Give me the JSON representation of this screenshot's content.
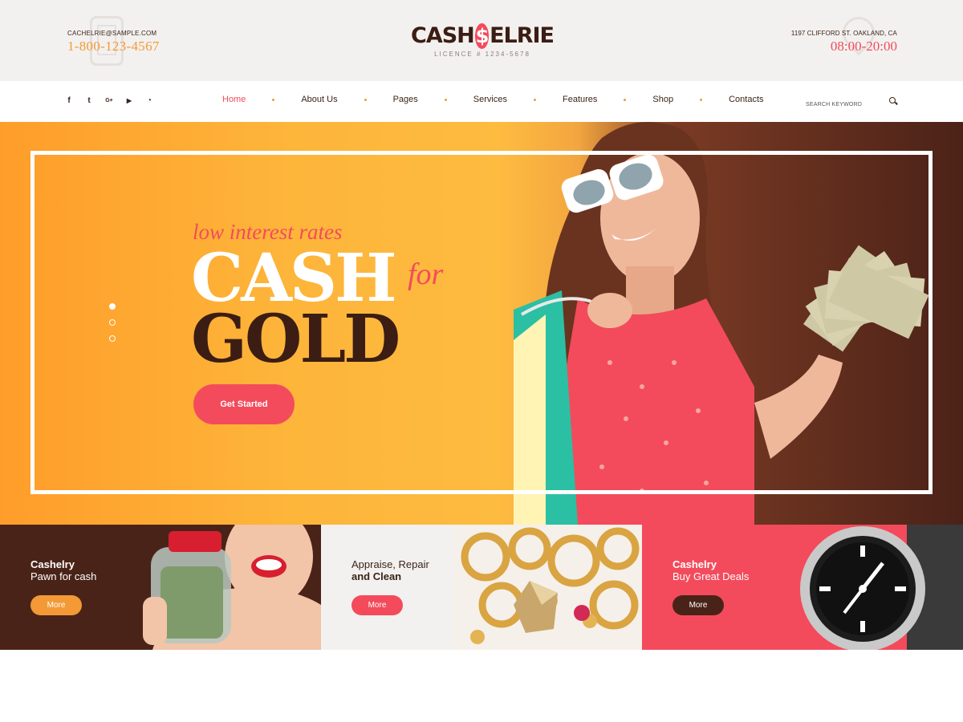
{
  "header": {
    "email": "CACHELRIE@SAMPLE.COM",
    "phone": "1-800-123-4567",
    "logo_left": "CASH",
    "logo_coin": "$",
    "logo_right": "ELRIE",
    "licence": "LICENCE # 1234-5678",
    "address": "1197 CLIFFORD ST. OAKLAND, CA",
    "hours": "08:00-20:00"
  },
  "social": [
    {
      "icon": "facebook-icon",
      "glyph": "f"
    },
    {
      "icon": "twitter-icon",
      "glyph": "t"
    },
    {
      "icon": "google-plus-icon",
      "glyph": "G+"
    },
    {
      "icon": "youtube-icon",
      "glyph": "▶"
    },
    {
      "icon": "rss-icon",
      "glyph": "◔"
    }
  ],
  "nav": {
    "items": [
      "Home",
      "About Us",
      "Pages",
      "Services",
      "Features",
      "Shop",
      "Contacts"
    ],
    "active": "Home"
  },
  "search": {
    "placeholder": "SEARCH KEYWORD"
  },
  "hero": {
    "tagline": "low interest rates",
    "line1": "CASH",
    "for": "for",
    "line2": "GOLD",
    "cta": "Get Started",
    "slides": 3,
    "active_slide": 1
  },
  "features": [
    {
      "title": "Cashelry",
      "subtitle": "Pawn for cash",
      "button": "More"
    },
    {
      "title": "Appraise, Repair",
      "subtitle": "and Clean",
      "button": "More"
    },
    {
      "title": "Cashelry",
      "subtitle": "Buy Great Deals",
      "button": "More"
    }
  ],
  "colors": {
    "accent_red": "#f34b5c",
    "accent_orange": "#f39a36",
    "dark_brown": "#3b1d14",
    "light_bg": "#f3f1ef"
  }
}
